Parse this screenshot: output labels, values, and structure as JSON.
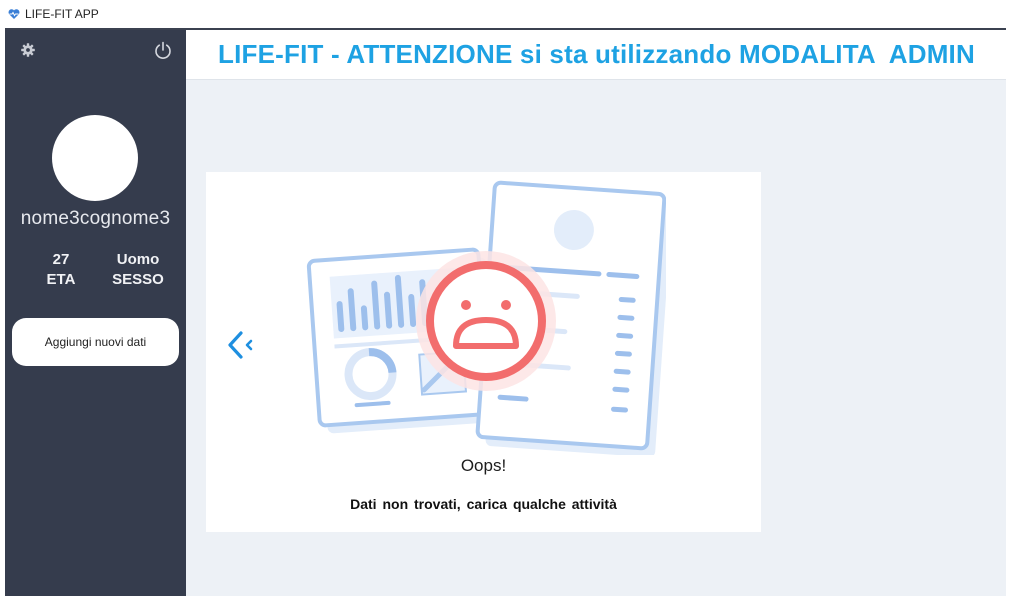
{
  "window": {
    "title": "LIFE-FIT APP",
    "icon": "heart-pulse-icon"
  },
  "sidebar": {
    "settings_icon": "gear-icon",
    "power_icon": "power-icon",
    "username": "nome3cognome3",
    "age": {
      "value": "27",
      "label": "ETA"
    },
    "sex": {
      "value": "Uomo",
      "label": "SESSO"
    },
    "add_button_label": "Aggiungi nuovi dati"
  },
  "header": {
    "title": "LIFE-FIT - ATTENZIONE si sta utilizzando MODALITA  ADMIN"
  },
  "empty_state": {
    "back_icon": "chevron-left-icon",
    "illustration": "sad-face-empty-data-illustration",
    "heading": "Oops!",
    "message": "Dati non trovati, carica qualche attività"
  },
  "colors": {
    "sidebar_bg": "#353c4d",
    "accent": "#1ea2e3",
    "main_bg": "#edf1f6",
    "sad_face": "#f26d6d",
    "illustration_blue": "#a9c8ef"
  }
}
